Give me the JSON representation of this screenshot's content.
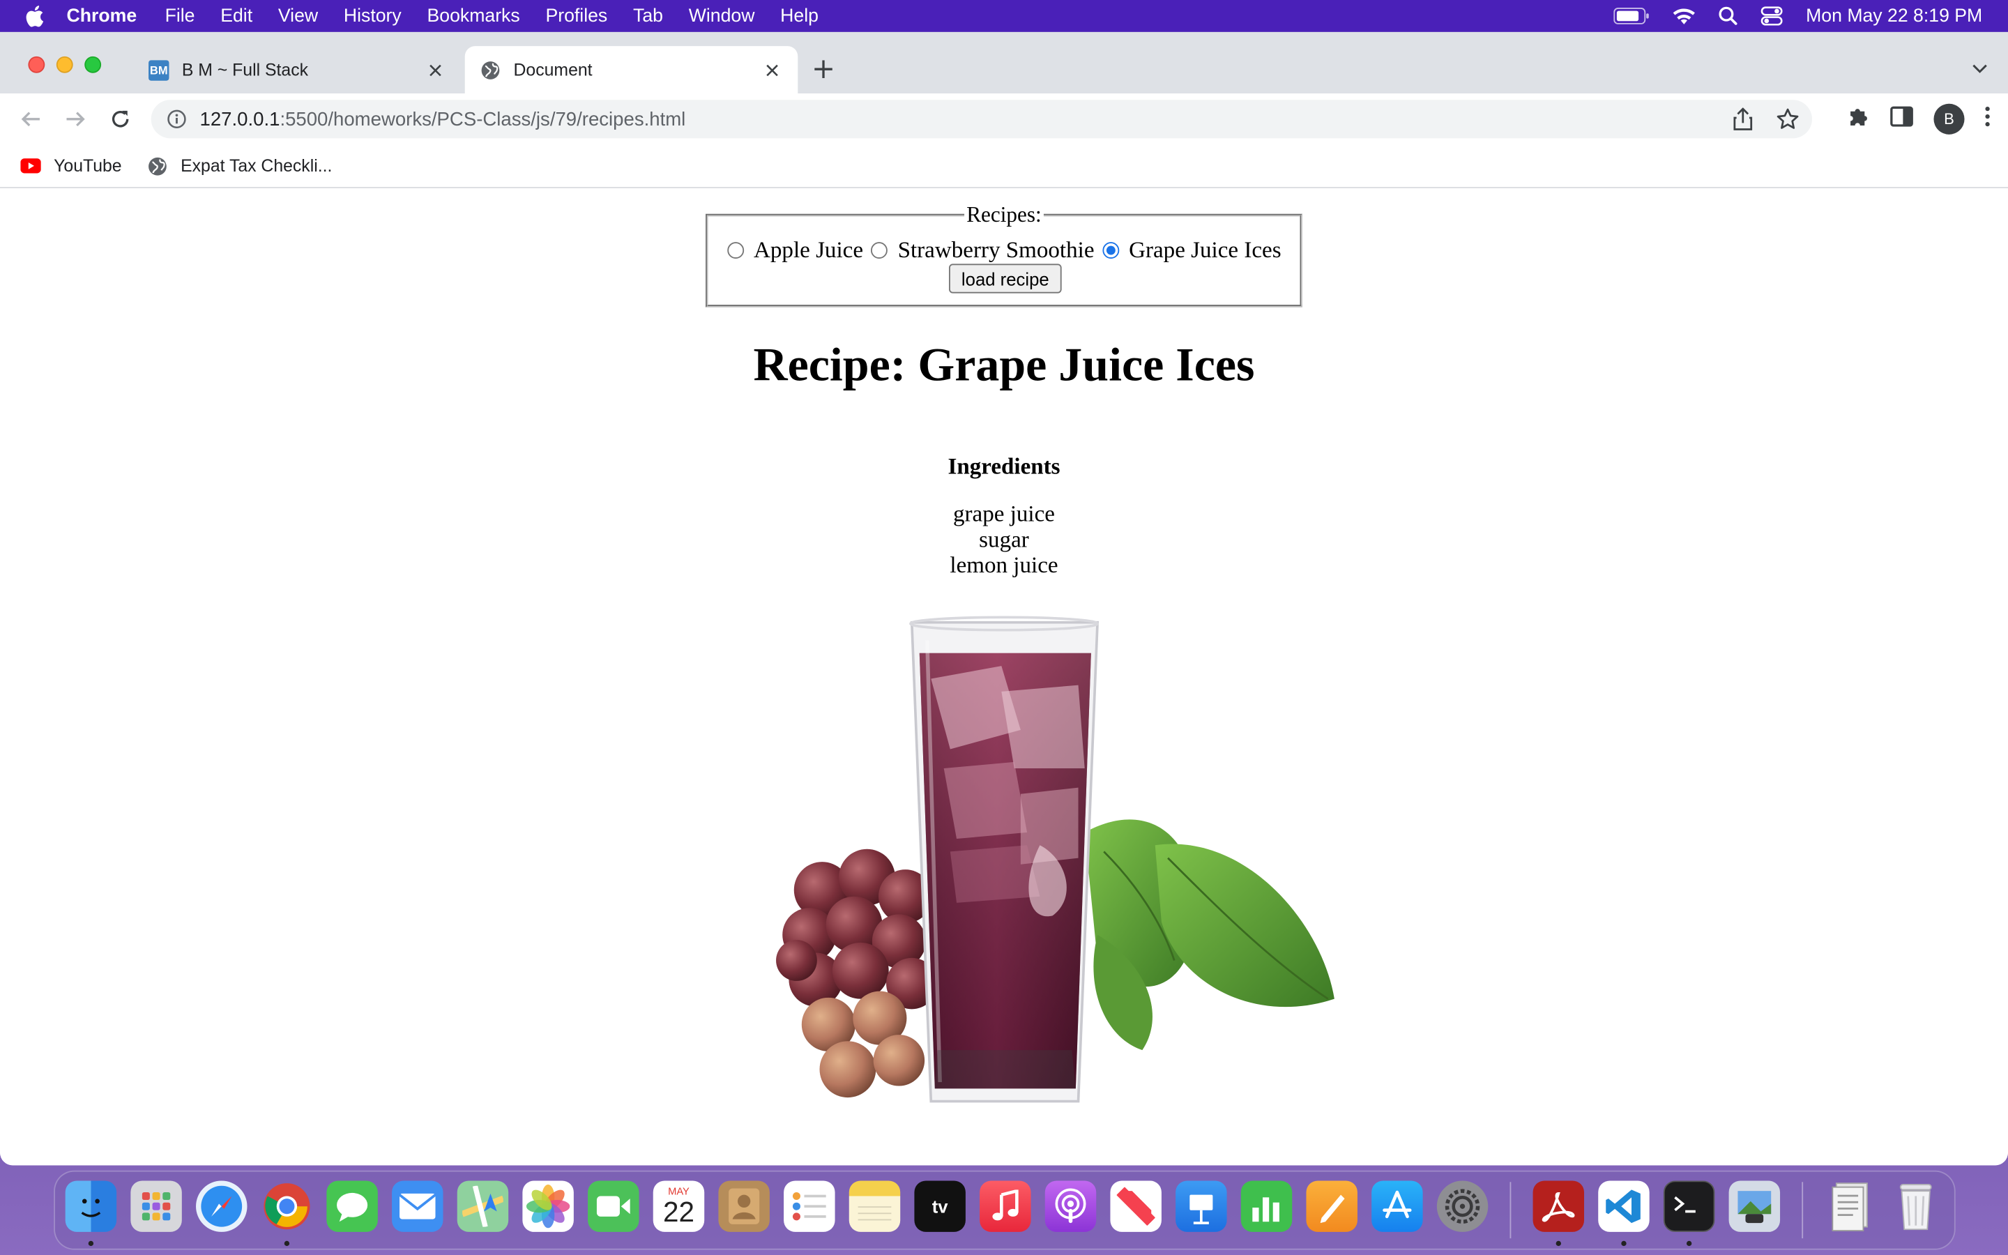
{
  "menubar": {
    "app_name": "Chrome",
    "items": [
      "File",
      "Edit",
      "View",
      "History",
      "Bookmarks",
      "Profiles",
      "Tab",
      "Window",
      "Help"
    ],
    "clock": "Mon May 22  8:19 PM"
  },
  "browser": {
    "tabs": [
      {
        "title": "B M ~ Full Stack",
        "favicon": "BM",
        "active": false
      },
      {
        "title": "Document",
        "favicon": "globe-icon",
        "active": true
      }
    ],
    "url_host": "127.0.0.1",
    "url_path": ":5500/homeworks/PCS-Class/js/79/recipes.html",
    "profile_initial": "B",
    "bookmarks": [
      {
        "label": "YouTube",
        "icon": "youtube-icon"
      },
      {
        "label": "Expat Tax Checkli...",
        "icon": "globe-icon"
      }
    ]
  },
  "page": {
    "legend": "Recipes:",
    "radios": [
      {
        "label": "Apple Juice",
        "checked": false
      },
      {
        "label": "Strawberry Smoothie",
        "checked": false
      },
      {
        "label": "Grape Juice Ices",
        "checked": true
      }
    ],
    "load_button": "load recipe",
    "recipe_title": "Recipe: Grape Juice Ices",
    "ingredients_heading": "Ingredients",
    "ingredients": [
      "grape juice",
      "sugar",
      "lemon juice"
    ]
  },
  "dock": {
    "calendar_month": "MAY",
    "calendar_day": "22",
    "apps": [
      "finder-icon",
      "launchpad-icon",
      "safari-icon",
      "chrome-icon",
      "messages-icon",
      "mail-icon",
      "maps-icon",
      "photos-icon",
      "facetime-icon",
      "calendar-icon",
      "contacts-icon",
      "reminders-icon",
      "notes-icon",
      "appletv-icon",
      "music-icon",
      "podcasts-icon",
      "news-icon",
      "keynote-icon",
      "numbers-icon",
      "pages-icon",
      "appstore-icon",
      "system-settings-icon",
      "acrobat-icon",
      "vscode-icon",
      "terminal-icon",
      "preview-icon",
      "documents-folder-icon",
      "trash-icon"
    ],
    "appletv_label": "tv"
  }
}
